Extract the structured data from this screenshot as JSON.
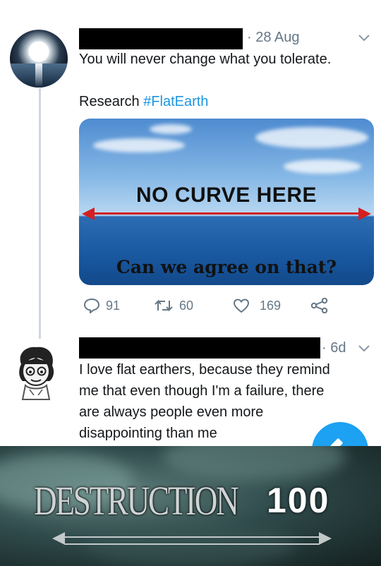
{
  "tweet1": {
    "date": "· 28 Aug",
    "text": "You will never change what you tolerate.",
    "caption_prefix": "Research ",
    "hashtag": "#FlatEarth",
    "image": {
      "headline": "NO CURVE HERE",
      "subline": "Can we agree on that?"
    },
    "stats": {
      "replies": "91",
      "retweets": "60",
      "likes": "169"
    }
  },
  "tweet2": {
    "date": "· 6d",
    "lines": [
      "I love flat earthers, because they remind",
      "me that even though I'm a failure, there",
      "are always people even more",
      "disappointing than me"
    ]
  },
  "meme": {
    "word": "DESTRUCTION",
    "number": "100"
  },
  "colors": {
    "link_blue": "#1b95e0",
    "fab_blue": "#1da1f2",
    "muted_gray": "#657786",
    "arrow_red": "#d42020"
  },
  "icons": [
    "chevron-down-icon",
    "reply-icon",
    "retweet-icon",
    "like-icon",
    "share-icon",
    "compose-icon"
  ]
}
